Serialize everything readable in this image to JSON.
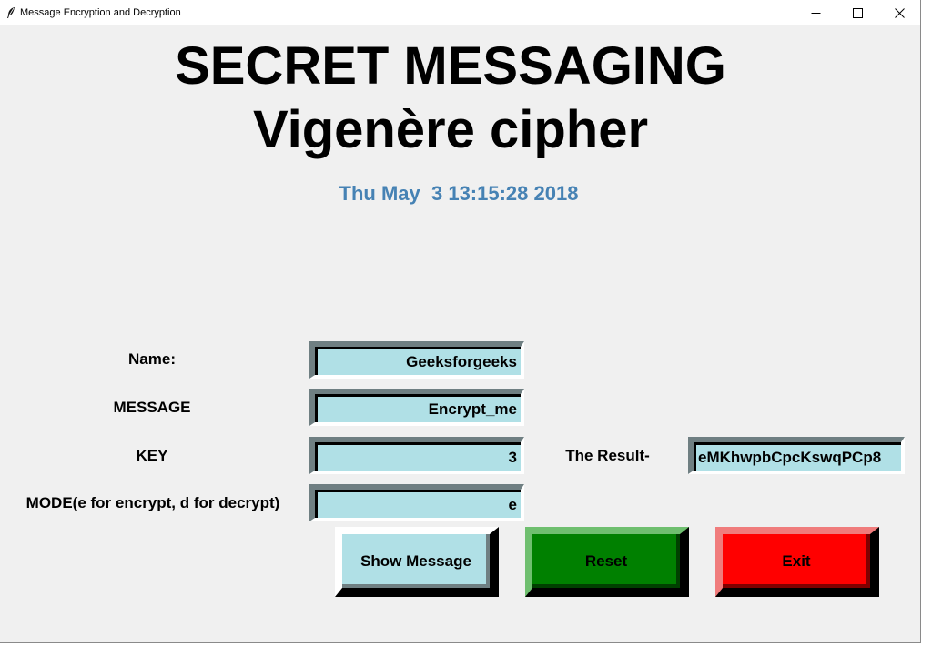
{
  "window": {
    "title": "Message Encryption and Decryption",
    "icon": "feather-icon",
    "controls": [
      "minimize-icon",
      "maximize-icon",
      "close-icon"
    ]
  },
  "header": {
    "title_line1": "SECRET MESSAGING",
    "title_line2": "Vigenère cipher",
    "datetime": "Thu May  3 13:15:28 2018"
  },
  "form": {
    "name_label": "Name:",
    "name_value": "Geeksforgeeks",
    "message_label": "MESSAGE",
    "message_value": "Encrypt_me",
    "key_label": "KEY",
    "key_value": "3",
    "mode_label": "MODE(e for encrypt, d for decrypt)",
    "mode_value": "e",
    "result_label": "The Result-",
    "result_value": "eMKhwpbCpcKswqPCp8"
  },
  "buttons": {
    "show_label": "Show Message",
    "reset_label": "Reset",
    "exit_label": "Exit"
  },
  "colors": {
    "background": "#f0f0f0",
    "entry_bg": "#b0e0e6",
    "datetime": "#4682b4",
    "reset_bg": "#008000",
    "exit_bg": "#ff0000"
  }
}
